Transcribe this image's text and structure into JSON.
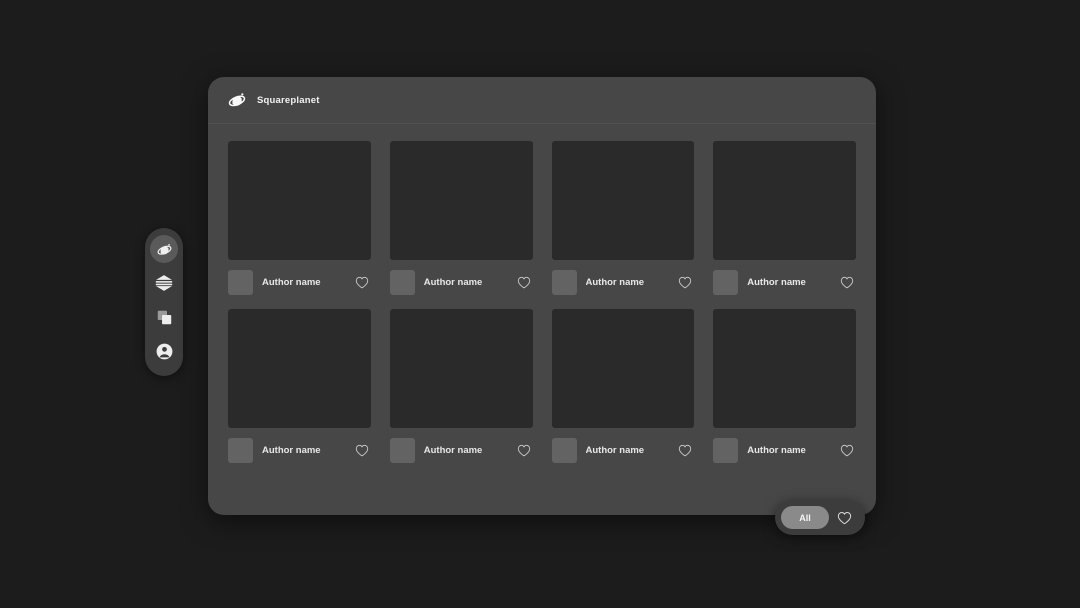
{
  "app": {
    "background_color": "#1c1c1c",
    "panel_color": "#474747",
    "thumb_color": "#2a2a2a",
    "avatar_color": "#636363",
    "chip_color": "#8a8a8a",
    "text_color": "#e8e8e8"
  },
  "sidebar": {
    "items": [
      {
        "name": "planet-logo-icon",
        "label": "Squareplanet",
        "active": true
      },
      {
        "name": "layers-icon",
        "label": "Layers",
        "active": false
      },
      {
        "name": "windows-icon",
        "label": "Windows",
        "active": false
      },
      {
        "name": "account-icon",
        "label": "Account",
        "active": false
      }
    ]
  },
  "header": {
    "logo_icon": "planet-logo-icon",
    "title": "Squareplanet"
  },
  "grid": {
    "cards": [
      {
        "author": "Author name",
        "like_icon": "heart-outline-icon"
      },
      {
        "author": "Author name",
        "like_icon": "heart-outline-icon"
      },
      {
        "author": "Author name",
        "like_icon": "heart-outline-icon"
      },
      {
        "author": "Author name",
        "like_icon": "heart-outline-icon"
      },
      {
        "author": "Author name",
        "like_icon": "heart-outline-icon"
      },
      {
        "author": "Author name",
        "like_icon": "heart-outline-icon"
      },
      {
        "author": "Author name",
        "like_icon": "heart-outline-icon"
      },
      {
        "author": "Author name",
        "like_icon": "heart-outline-icon"
      }
    ]
  },
  "filter_pill": {
    "selected_label": "All",
    "like_icon": "heart-outline-icon"
  }
}
